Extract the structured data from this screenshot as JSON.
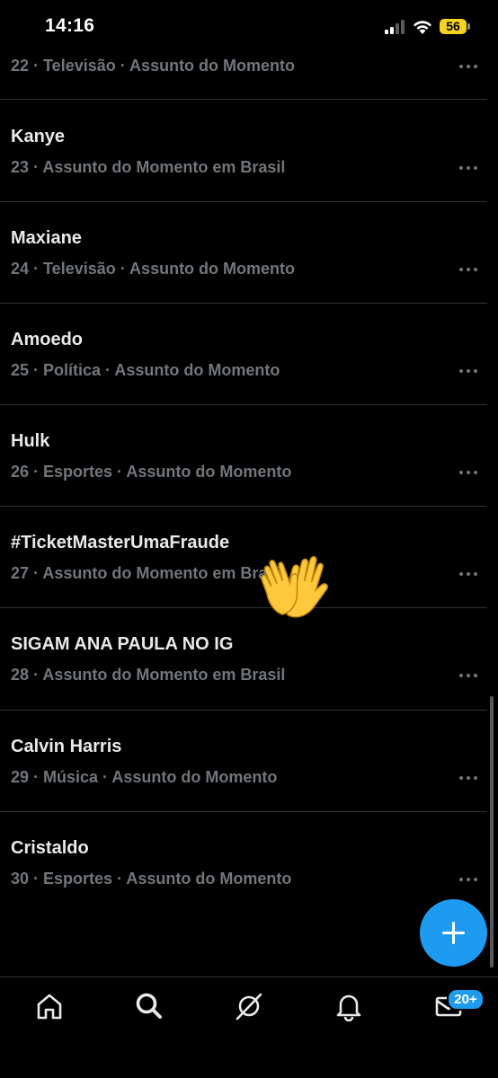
{
  "status_bar": {
    "time": "14:16",
    "battery": "56"
  },
  "trends": [
    {
      "title": "",
      "meta": "22 · Televisão · Assunto do Momento"
    },
    {
      "title": "Kanye",
      "meta": "23 · Assunto do Momento em Brasil"
    },
    {
      "title": "Maxiane",
      "meta": "24 · Televisão · Assunto do Momento"
    },
    {
      "title": "Amoedo",
      "meta": "25 · Política · Assunto do Momento"
    },
    {
      "title": "Hulk",
      "meta": "26 · Esportes · Assunto do Momento"
    },
    {
      "title": "#TicketMasterUmaFraude",
      "meta": "27 · Assunto do Momento em Brasil"
    },
    {
      "title": "SIGAM ANA PAULA NO IG",
      "meta": "28 · Assunto do Momento em Brasil"
    },
    {
      "title": "Calvin Harris",
      "meta": "29 · Música · Assunto do Momento"
    },
    {
      "title": "Cristaldo",
      "meta": "30 · Esportes · Assunto do Momento"
    }
  ],
  "fab": {
    "icon": "plus-icon"
  },
  "bottom_nav": {
    "items": [
      {
        "icon": "home-icon"
      },
      {
        "icon": "search-icon"
      },
      {
        "icon": "grok-icon"
      },
      {
        "icon": "bell-icon"
      },
      {
        "icon": "mail-icon",
        "badge": "20+"
      }
    ]
  },
  "overlay": {
    "icon": "waving-hands-emoji"
  },
  "colors": {
    "accent": "#1d9bf0",
    "background": "#000000",
    "text": "#e7e9ea",
    "muted": "#71767b",
    "divider": "#2f3336"
  }
}
